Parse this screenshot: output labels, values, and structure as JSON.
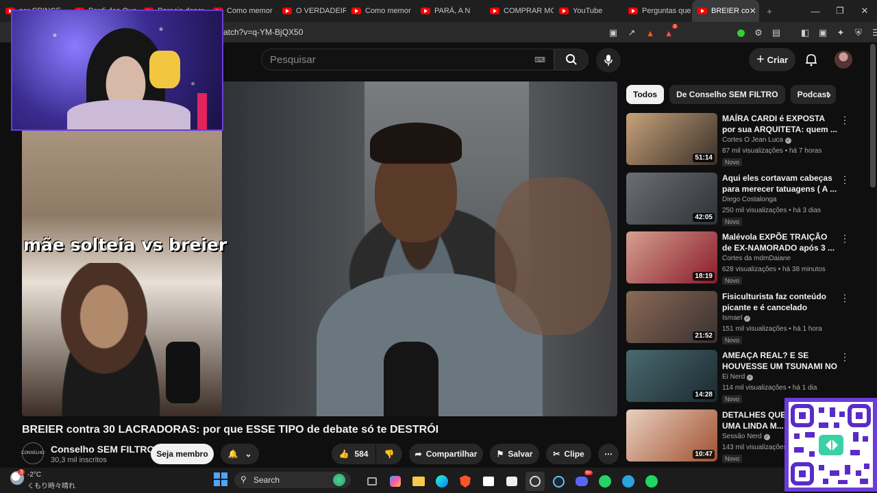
{
  "browser": {
    "tabs": [
      {
        "label": "ser CRINGE",
        "active": false
      },
      {
        "label": "Perdi das Que",
        "active": false
      },
      {
        "label": "Parecia descr",
        "active": false
      },
      {
        "label": "Como memor",
        "active": false
      },
      {
        "label": "O VERDADEIR",
        "active": false
      },
      {
        "label": "Como memor",
        "active": false
      },
      {
        "label": "PARÁ, A N",
        "active": false
      },
      {
        "label": "COMPRAR MC",
        "active": false
      },
      {
        "label": "YouTube",
        "active": false
      },
      {
        "label": "Perguntas que",
        "active": false
      },
      {
        "label": "BREIER co",
        "active": true
      }
    ],
    "new_tab": "+",
    "url": "atch?v=q-YM-BjQX50",
    "brave_badge": "1"
  },
  "youtube": {
    "search_placeholder": "Pesquisar",
    "create_label": "Criar"
  },
  "video": {
    "overlay_text": "mãe solteia vs breier",
    "title": "BREIER contra 30 LACRADORAS: por que ESSE TIPO de debate só te DESTRÓI",
    "channel_name": "Conselho SEM FILTRO",
    "channel_avatar_text": "CONSELHO",
    "subscribers": "30,3 mil inscritos",
    "member_label": "Seja membro",
    "likes": "584",
    "share_label": "Compartilhar",
    "save_label": "Salvar",
    "clip_label": "Clipe"
  },
  "chips": [
    "Todos",
    "De Conselho SEM FILTRO",
    "Podcast"
  ],
  "recommendations": [
    {
      "title": "MAÍRA CARDI é EXPOSTA por sua ARQUITETA: quem ...",
      "channel": "Cortes O Jean Luca",
      "verified": true,
      "meta": "87 mil visualizações • há 7 horas",
      "badge": "Novo",
      "duration": "51:14",
      "color1": "#c7a27a",
      "color2": "#3a2f29"
    },
    {
      "title": "Aqui eles cortavam cabeças para merecer tatuagens ( A ...",
      "channel": "Diego Costalonga",
      "verified": false,
      "meta": "250 mil visualizações • há 3 dias",
      "badge": "Novo",
      "duration": "42:05",
      "color1": "#6b6f73",
      "color2": "#2e3236"
    },
    {
      "title": "Malévola EXPÕE TRAIÇÃO de EX-NAMORADO após 3 ...",
      "channel": "Cortes da mdmDaiane",
      "verified": false,
      "meta": "628 visualizações • há 38 minutos",
      "badge": "Novo",
      "duration": "18:19",
      "color1": "#d4a090",
      "color2": "#8b1a2a"
    },
    {
      "title": "Fisiculturista faz conteúdo picante e é cancelado",
      "channel": "Ismael",
      "verified": true,
      "meta": "151 mil visualizações • há 1 hora",
      "badge": "Novo",
      "duration": "21:52",
      "color1": "#8a6a55",
      "color2": "#3a3030"
    },
    {
      "title": "AMEAÇA REAL? E SE HOUVESSE UM TSUNAMI NO ...",
      "channel": "Ei Nerd",
      "verified": true,
      "meta": "114 mil visualizações • há 1 dia",
      "badge": "Novo",
      "duration": "14:28",
      "color1": "#4a6a70",
      "color2": "#1a2a30"
    },
    {
      "title": "DETALHES QUE VOCÊ... em UMA LINDA M...",
      "channel": "Sessão Nerd",
      "verified": true,
      "meta": "143 mil visualizações",
      "badge": "Novo",
      "duration": "10:47",
      "color1": "#e8d0c0",
      "color2": "#a05030"
    }
  ],
  "taskbar": {
    "weather_temp": "-2°C",
    "weather_desc": "くもり時々晴れ",
    "weather_badge": "3",
    "search_label": "Search",
    "discord_badge": "9+"
  }
}
